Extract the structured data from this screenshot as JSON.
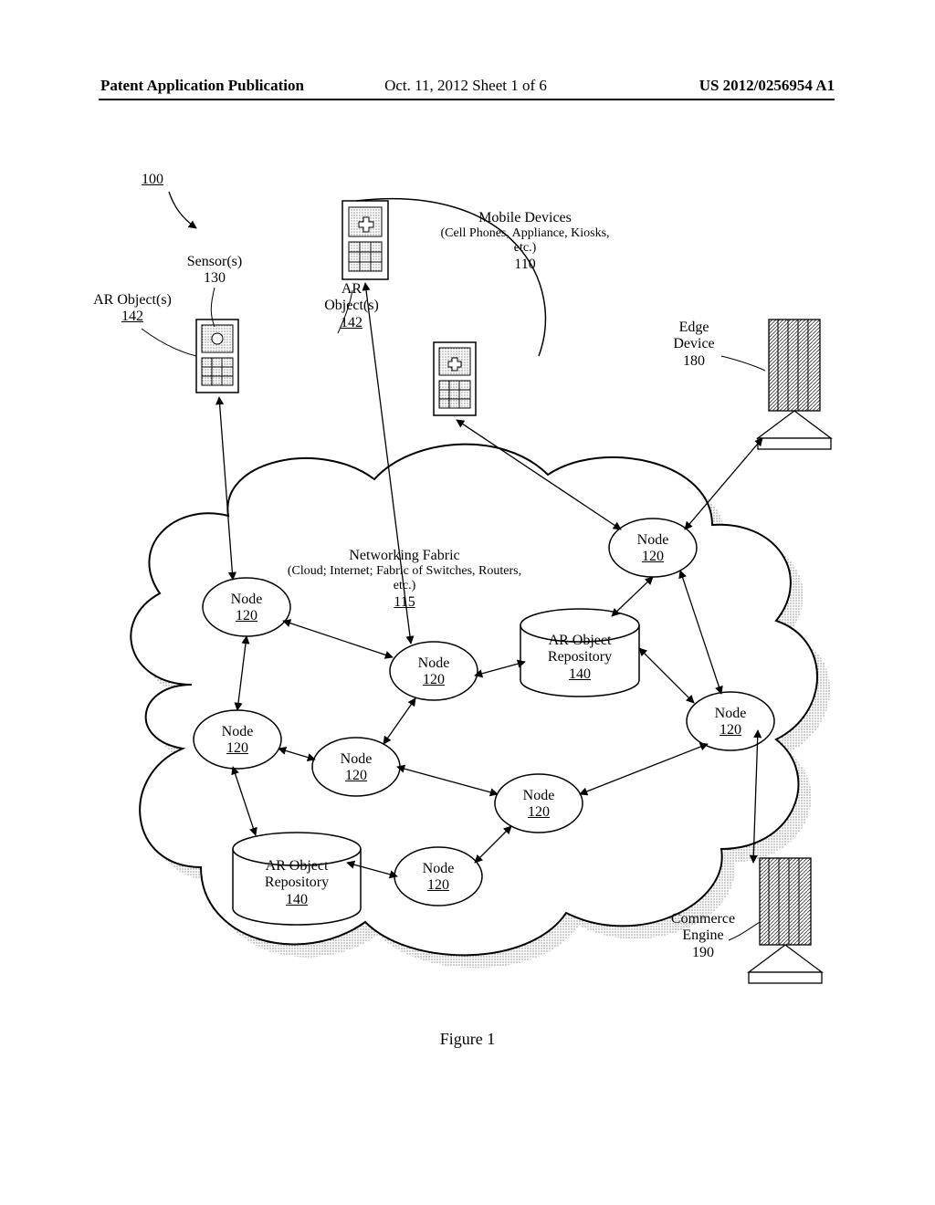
{
  "header": {
    "left": "Patent Application Publication",
    "middle": "Oct. 11, 2012  Sheet 1 of 6",
    "right": "US 2012/0256954 A1"
  },
  "figure_caption": "Figure 1",
  "labels": {
    "system_ref": "100",
    "mobile_devices_title": "Mobile Devices",
    "mobile_devices_sub": "(Cell Phones, Appliance, Kiosks, etc.)",
    "mobile_devices_ref": "110",
    "sensors_title": "Sensor(s)",
    "sensors_ref": "130",
    "ar_obj_left_title": "AR Object(s)",
    "ar_obj_left_ref": "142",
    "ar_obj_mid_title": "AR Object(s)",
    "ar_obj_mid_ref": "142",
    "ar_line1": "AR",
    "edge_device_title": "Edge Device",
    "edge_device_ref": "180",
    "fabric_line1": "Networking Fabric",
    "fabric_line2": "(Cloud; Internet; Fabric of Switches, Routers, etc.)",
    "fabric_ref": "115",
    "node_label": "Node",
    "node_ref": "120",
    "repo_line1": "AR Object",
    "repo_line2": "Repository",
    "repo_ref": "140",
    "commerce_line1": "Commerce",
    "commerce_line2": "Engine",
    "commerce_ref": "190"
  }
}
